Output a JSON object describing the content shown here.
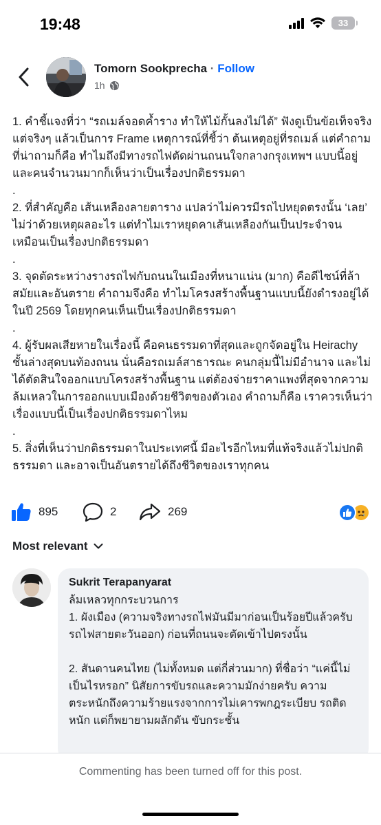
{
  "status_bar": {
    "time": "19:48",
    "battery": "33",
    "icons": [
      "signal-icon",
      "wifi-icon",
      "battery-icon"
    ]
  },
  "header": {
    "author": "Tomorn Sookprecha",
    "separator": "·",
    "follow_label": "Follow",
    "time_ago": "1h",
    "privacy_icon": "globe-icon"
  },
  "post": {
    "paragraphs": [
      "1. คำชี้แจงที่ว่า “รถเมล์จอดค้ำราง ทำให้ไม้กั้นลงไม่ได้” ฟังดูเป็นข้อเท็จจริง แต่จริงๆ แล้วเป็นการ Frame เหตุการณ์ที่ชี้ว่า ต้นเหตุอยู่ที่รถเมล์ แต่คำถามที่น่าถามก็คือ ทำไมถึงมีทางรถไฟตัดผ่านถนนใจกลางกรุงเทพฯ แบบนี้อยู่ และคนจำนวนมากก็เห็นว่าเป็นเรื่องปกติธรรมดา\n.",
      "2. ที่สำคัญคือ เส้นเหลืองลายตาราง แปลว่าไม่ควรมีรถไปหยุดตรงนั้น ‘เลย’ ไม่ว่าด้วยเหตุผลอะไร แต่ทำไมเราหยุดคาเส้นเหลืองกันเป็นประจำจนเหมือนเป็นเรื่องปกติธรรมดา\n.",
      "3. จุดตัดระหว่างรางรถไฟกับถนนในเมืองที่หนาแน่น (มาก) คือดีไซน์ที่ล้าสมัยและอันตราย คำถามจึงคือ ทำไมโครงสร้างพื้นฐานแบบนี้ยังดำรงอยู่ได้ในปี 2569 โดยทุกคนเห็นเป็นเรื่องปกติธรรมดา\n.",
      "4. ผู้รับผลเสียหายในเรื่องนี้ คือคนธรรมดาที่สุดและถูกจัดอยู่ใน Heirachy ชั้นล่างสุดบนท้องถนน นั่นคือรถเมล์สาธารณะ คนกลุ่มนี้ไม่มีอำนาจ และไม่ได้ตัดสินใจออกแบบโครงสร้างพื้นฐาน แต่ต้องจ่ายราคาแพงที่สุดจากความล้มเหลวในการออกแบบเมืองด้วยชีวิตของตัวเอง คำถามก็คือ เราควรเห็นว่าเรื่องแบบนี้เป็นเรื่องปกติธรรมดาไหม\n.",
      "5. สิ่งที่เห็นว่าปกติธรรมดาในประเทศนี้ มีอะไรอีกไหมที่แท้จริงแล้วไม่ปกติธรรมดา และอาจเป็นอันตรายได้ถึงชีวิตของเราทุกคน"
    ]
  },
  "reactions": {
    "likes": "895",
    "comments": "2",
    "shares": "269",
    "reaction_icons": [
      "like-reaction-icon",
      "sad-reaction-icon"
    ]
  },
  "sort": {
    "label": "Most relevant"
  },
  "comment": {
    "name": "Sukrit Terapanyarat",
    "text": "ล้มเหลวทุกกระบวนการ\n1. ผังเมือง (ความจริงทางรถไฟมันมีมาก่อนเป็นร้อยปีแล้วครับ  รถไฟสายตะวันออก) ก่อนที่ถนนจะตัดเข้าไปตรงนั้น\n\n2. สันดานคนไทย (ไม่ทั้งหมด แต่กี่ส่วนมาก) ที่ชื่อว่า “แค่นี้ไม่เป็นไรหรอก” นิสัยการขับรถและความมักง่ายครับ  ความตระหนักถึงความร้ายแรงจากการไม่เคารพกฎระเบียบ    รถติดหนัก แต่ก็พยายามผลักดัน ขับกระชั้น"
  },
  "footer": {
    "text": "Commenting has been turned off for this post."
  },
  "colors": {
    "accent": "#0866ff",
    "secondary_text": "#65676b",
    "bubble": "#f0f2f5"
  }
}
